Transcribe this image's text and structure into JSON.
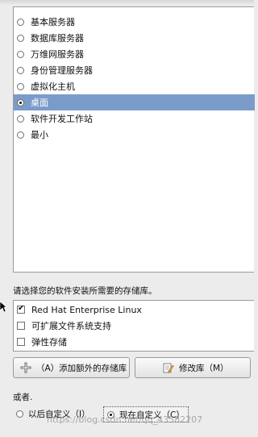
{
  "options": [
    {
      "label": "基本服务器",
      "selected": false
    },
    {
      "label": "数据库服务器",
      "selected": false
    },
    {
      "label": "万维网服务器",
      "selected": false
    },
    {
      "label": "身份管理服务器",
      "selected": false
    },
    {
      "label": "虚拟化主机",
      "selected": false
    },
    {
      "label": "桌面",
      "selected": true
    },
    {
      "label": "软件开发工作站",
      "selected": false
    },
    {
      "label": "最小",
      "selected": false
    }
  ],
  "repo_prompt": "请选择您的软件安装所需要的存储库。",
  "repos": [
    {
      "label": "Red Hat Enterprise Linux",
      "checked": true
    },
    {
      "label": "可扩展文件系统支持",
      "checked": false
    },
    {
      "label": "弹性存储",
      "checked": false
    }
  ],
  "buttons": {
    "add_repo": "（A）添加额外的存储库",
    "modify_repo": "修改库（M）"
  },
  "or_label": "或者.",
  "customize": {
    "later": "以后自定义（I）",
    "now": "现在自定义（C）"
  },
  "watermark": "https://blog.csdn.net/qq_43582207",
  "colors": {
    "selected_row": "#7b9ccb"
  }
}
